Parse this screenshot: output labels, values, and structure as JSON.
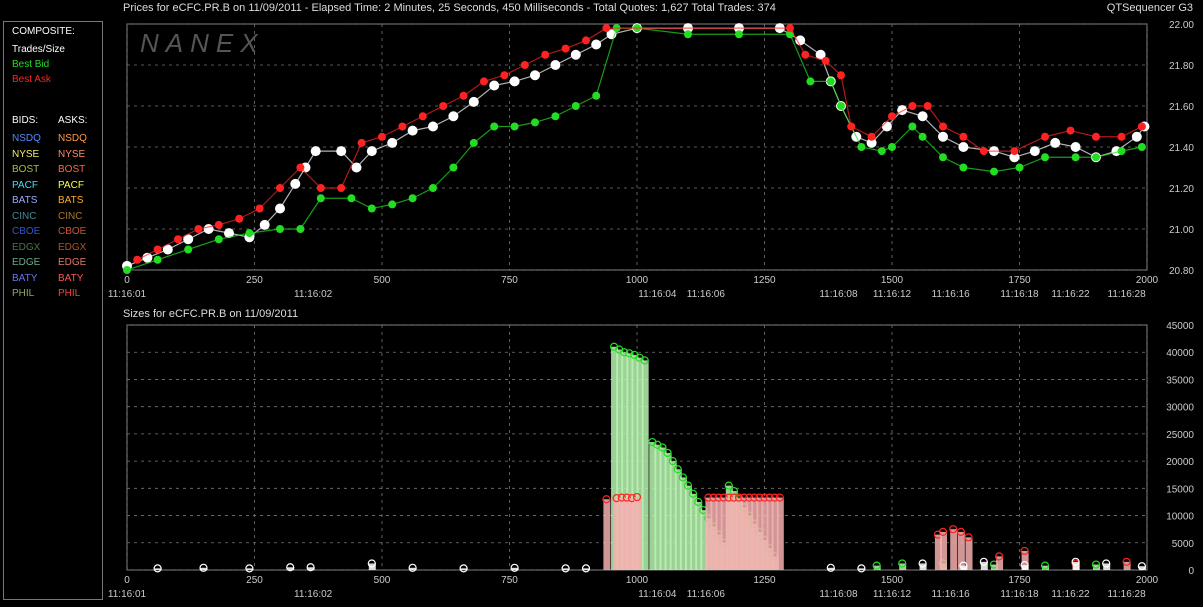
{
  "header": {
    "left": "Prices for  eCFC.PR.B  on  11/09/2011  -  Elapsed Time: 2 Minutes, 25 Seconds, 450 Milliseconds  -  Total Quotes: 1,627  Total Trades: 374",
    "right": "QTSequencer G3"
  },
  "sizes_title": "Sizes for  eCFC.PR.B  on  11/09/2011",
  "watermark": "NANEX",
  "legend": {
    "composite_title": "COMPOSITE:",
    "composite": [
      {
        "label": "Trades/Size",
        "color": "#ffffff"
      },
      {
        "label": "Best Bid",
        "color": "#22dd22"
      },
      {
        "label": "Best Ask",
        "color": "#ff2222"
      }
    ],
    "bids_title": "BIDS:",
    "asks_title": "ASKS:",
    "exchanges": [
      {
        "bid": "NSDQ",
        "ask": "NSDQ",
        "bid_color": "#5588ff",
        "ask_color": "#ff9944"
      },
      {
        "bid": "NYSE",
        "ask": "NYSE",
        "bid_color": "#eeee66",
        "ask_color": "#ff8866"
      },
      {
        "bid": "BOST",
        "ask": "BOST",
        "bid_color": "#aabb44",
        "ask_color": "#ff6644"
      },
      {
        "bid": "PACF",
        "ask": "PACF",
        "bid_color": "#44ddff",
        "ask_color": "#ffff44"
      },
      {
        "bid": "BATS",
        "ask": "BATS",
        "bid_color": "#99aaff",
        "ask_color": "#ffaa33"
      },
      {
        "bid": "CINC",
        "ask": "CINC",
        "bid_color": "#448899",
        "ask_color": "#aa7733"
      },
      {
        "bid": "CBOE",
        "ask": "CBOE",
        "bid_color": "#3355cc",
        "ask_color": "#cc5533"
      },
      {
        "bid": "EDGX",
        "ask": "EDGX",
        "bid_color": "#447744",
        "ask_color": "#aa5522"
      },
      {
        "bid": "EDGE",
        "ask": "EDGE",
        "bid_color": "#66aa88",
        "ask_color": "#dd7766"
      },
      {
        "bid": "BATY",
        "ask": "BATY",
        "bid_color": "#6677ee",
        "ask_color": "#ff5555"
      },
      {
        "bid": "PHIL",
        "ask": "PHIL",
        "bid_color": "#88aa66",
        "ask_color": "#ee4444"
      }
    ]
  },
  "chart_data": [
    {
      "type": "scatter",
      "title": "Prices for  eCFC.PR.B  on  11/09/2011",
      "xlim": [
        0,
        2000
      ],
      "ylim": [
        20.8,
        22.0
      ],
      "x_ticks": [
        0,
        250,
        500,
        750,
        1000,
        1250,
        1500,
        1750,
        2000
      ],
      "y_ticks": [
        20.8,
        21.0,
        21.2,
        21.4,
        21.6,
        21.8,
        22.0
      ],
      "y_tick_labels": [
        "20.80",
        "21.00",
        "21.20",
        "21.40",
        "21.60",
        "21.80",
        "22.00"
      ],
      "time_labels": [
        {
          "x": 0,
          "label": "11:16:01"
        },
        {
          "x": 365,
          "label": "11:16:02"
        },
        {
          "x": 1040,
          "label": "11:16:04"
        },
        {
          "x": 1135,
          "label": "11:16:06"
        },
        {
          "x": 1395,
          "label": "11:16:08"
        },
        {
          "x": 1500,
          "label": "11:16:12"
        },
        {
          "x": 1615,
          "label": "11:16:16"
        },
        {
          "x": 1750,
          "label": "11:16:18"
        },
        {
          "x": 1850,
          "label": "11:16:22"
        },
        {
          "x": 1960,
          "label": "11:16:28"
        }
      ],
      "series": [
        {
          "name": "Trades/Size",
          "color": "#ffffff",
          "points": [
            [
              0,
              20.82
            ],
            [
              40,
              20.86
            ],
            [
              80,
              20.9
            ],
            [
              120,
              20.95
            ],
            [
              160,
              21.0
            ],
            [
              200,
              20.98
            ],
            [
              240,
              20.96
            ],
            [
              270,
              21.02
            ],
            [
              300,
              21.1
            ],
            [
              330,
              21.22
            ],
            [
              350,
              21.3
            ],
            [
              370,
              21.38
            ],
            [
              420,
              21.38
            ],
            [
              450,
              21.3
            ],
            [
              480,
              21.38
            ],
            [
              520,
              21.42
            ],
            [
              560,
              21.48
            ],
            [
              600,
              21.5
            ],
            [
              640,
              21.55
            ],
            [
              680,
              21.62
            ],
            [
              720,
              21.7
            ],
            [
              760,
              21.72
            ],
            [
              800,
              21.75
            ],
            [
              840,
              21.8
            ],
            [
              880,
              21.85
            ],
            [
              920,
              21.9
            ],
            [
              950,
              21.95
            ],
            [
              1000,
              21.98
            ],
            [
              1100,
              21.98
            ],
            [
              1200,
              21.98
            ],
            [
              1280,
              21.98
            ],
            [
              1320,
              21.92
            ],
            [
              1360,
              21.85
            ],
            [
              1380,
              21.72
            ],
            [
              1400,
              21.6
            ],
            [
              1430,
              21.45
            ],
            [
              1460,
              21.42
            ],
            [
              1490,
              21.5
            ],
            [
              1520,
              21.58
            ],
            [
              1560,
              21.55
            ],
            [
              1600,
              21.45
            ],
            [
              1640,
              21.4
            ],
            [
              1700,
              21.38
            ],
            [
              1740,
              21.35
            ],
            [
              1780,
              21.38
            ],
            [
              1820,
              21.42
            ],
            [
              1860,
              21.4
            ],
            [
              1900,
              21.35
            ],
            [
              1940,
              21.38
            ],
            [
              1980,
              21.45
            ],
            [
              1995,
              21.5
            ]
          ]
        },
        {
          "name": "Best Bid",
          "color": "#22dd22",
          "points": [
            [
              0,
              20.8
            ],
            [
              60,
              20.85
            ],
            [
              120,
              20.9
            ],
            [
              180,
              20.95
            ],
            [
              240,
              20.98
            ],
            [
              300,
              21.0
            ],
            [
              340,
              21.0
            ],
            [
              380,
              21.15
            ],
            [
              440,
              21.15
            ],
            [
              480,
              21.1
            ],
            [
              520,
              21.12
            ],
            [
              560,
              21.15
            ],
            [
              600,
              21.2
            ],
            [
              640,
              21.3
            ],
            [
              680,
              21.42
            ],
            [
              720,
              21.5
            ],
            [
              760,
              21.5
            ],
            [
              800,
              21.52
            ],
            [
              840,
              21.55
            ],
            [
              880,
              21.6
            ],
            [
              920,
              21.65
            ],
            [
              960,
              21.98
            ],
            [
              1000,
              21.98
            ],
            [
              1100,
              21.95
            ],
            [
              1200,
              21.95
            ],
            [
              1300,
              21.95
            ],
            [
              1340,
              21.72
            ],
            [
              1380,
              21.72
            ],
            [
              1400,
              21.6
            ],
            [
              1440,
              21.4
            ],
            [
              1480,
              21.38
            ],
            [
              1500,
              21.4
            ],
            [
              1540,
              21.5
            ],
            [
              1560,
              21.45
            ],
            [
              1600,
              21.35
            ],
            [
              1640,
              21.3
            ],
            [
              1700,
              21.28
            ],
            [
              1750,
              21.3
            ],
            [
              1800,
              21.35
            ],
            [
              1860,
              21.35
            ],
            [
              1900,
              21.35
            ],
            [
              1950,
              21.38
            ],
            [
              1990,
              21.4
            ]
          ]
        },
        {
          "name": "Best Ask",
          "color": "#ff2222",
          "points": [
            [
              20,
              20.85
            ],
            [
              60,
              20.9
            ],
            [
              100,
              20.95
            ],
            [
              140,
              21.0
            ],
            [
              180,
              21.02
            ],
            [
              220,
              21.05
            ],
            [
              260,
              21.1
            ],
            [
              300,
              21.2
            ],
            [
              340,
              21.3
            ],
            [
              380,
              21.2
            ],
            [
              420,
              21.2
            ],
            [
              460,
              21.42
            ],
            [
              500,
              21.45
            ],
            [
              540,
              21.5
            ],
            [
              580,
              21.55
            ],
            [
              620,
              21.6
            ],
            [
              660,
              21.65
            ],
            [
              700,
              21.72
            ],
            [
              740,
              21.75
            ],
            [
              780,
              21.8
            ],
            [
              820,
              21.85
            ],
            [
              860,
              21.88
            ],
            [
              900,
              21.92
            ],
            [
              940,
              21.98
            ],
            [
              1300,
              21.98
            ],
            [
              1330,
              21.85
            ],
            [
              1370,
              21.82
            ],
            [
              1400,
              21.75
            ],
            [
              1420,
              21.5
            ],
            [
              1460,
              21.45
            ],
            [
              1500,
              21.55
            ],
            [
              1540,
              21.6
            ],
            [
              1570,
              21.6
            ],
            [
              1600,
              21.5
            ],
            [
              1640,
              21.45
            ],
            [
              1680,
              21.38
            ],
            [
              1740,
              21.38
            ],
            [
              1800,
              21.45
            ],
            [
              1850,
              21.48
            ],
            [
              1900,
              21.45
            ],
            [
              1950,
              21.45
            ],
            [
              1990,
              21.5
            ]
          ]
        }
      ]
    },
    {
      "type": "bar",
      "title": "Sizes for  eCFC.PR.B  on  11/09/2011",
      "xlim": [
        0,
        2000
      ],
      "ylim": [
        0,
        45000
      ],
      "x_ticks": [
        0,
        250,
        500,
        750,
        1000,
        1250,
        1500,
        1750,
        2000
      ],
      "y_ticks": [
        0,
        5000,
        10000,
        15000,
        20000,
        25000,
        30000,
        35000,
        40000,
        45000
      ],
      "series": [
        {
          "name": "Best Bid",
          "color": "#22dd22",
          "points": [
            [
              955,
              41000
            ],
            [
              965,
              40500
            ],
            [
              975,
              40000
            ],
            [
              985,
              39800
            ],
            [
              995,
              39500
            ],
            [
              1005,
              39000
            ],
            [
              1015,
              38500
            ],
            [
              1030,
              23500
            ],
            [
              1040,
              23000
            ],
            [
              1050,
              22500
            ],
            [
              1060,
              21500
            ],
            [
              1070,
              20000
            ],
            [
              1080,
              18500
            ],
            [
              1090,
              17000
            ],
            [
              1100,
              15500
            ],
            [
              1110,
              14000
            ],
            [
              1120,
              12500
            ],
            [
              1130,
              11000
            ],
            [
              1140,
              9500
            ],
            [
              1150,
              8000
            ],
            [
              1160,
              6500
            ],
            [
              1170,
              5000
            ],
            [
              1180,
              15500
            ],
            [
              1190,
              14500
            ],
            [
              1200,
              13000
            ],
            [
              1210,
              11500
            ],
            [
              1220,
              10000
            ],
            [
              1230,
              8500
            ],
            [
              1240,
              7000
            ],
            [
              1250,
              5500
            ],
            [
              1260,
              4000
            ],
            [
              1270,
              2500
            ],
            [
              1470,
              800
            ],
            [
              1520,
              1200
            ],
            [
              1600,
              1200
            ],
            [
              1700,
              1000
            ],
            [
              1800,
              800
            ],
            [
              1900,
              1000
            ]
          ]
        },
        {
          "name": "Best Ask",
          "color": "#ff2222",
          "points": [
            [
              940,
              13000
            ],
            [
              960,
              13200
            ],
            [
              970,
              13300
            ],
            [
              980,
              13300
            ],
            [
              990,
              13200
            ],
            [
              1000,
              13400
            ],
            [
              1140,
              13300
            ],
            [
              1150,
              13300
            ],
            [
              1160,
              13300
            ],
            [
              1170,
              13300
            ],
            [
              1180,
              13300
            ],
            [
              1190,
              13300
            ],
            [
              1200,
              13300
            ],
            [
              1210,
              13300
            ],
            [
              1220,
              13300
            ],
            [
              1230,
              13300
            ],
            [
              1240,
              13300
            ],
            [
              1250,
              13300
            ],
            [
              1260,
              13300
            ],
            [
              1270,
              13300
            ],
            [
              1280,
              13300
            ],
            [
              1590,
              6500
            ],
            [
              1600,
              7000
            ],
            [
              1620,
              7500
            ],
            [
              1635,
              7000
            ],
            [
              1650,
              6000
            ],
            [
              1710,
              2500
            ],
            [
              1760,
              3500
            ],
            [
              1860,
              1200
            ],
            [
              1960,
              1500
            ]
          ]
        },
        {
          "name": "Trades/Size",
          "color": "#ffffff",
          "points": [
            [
              60,
              300
            ],
            [
              150,
              400
            ],
            [
              240,
              300
            ],
            [
              320,
              500
            ],
            [
              360,
              500
            ],
            [
              480,
              1200
            ],
            [
              560,
              400
            ],
            [
              660,
              300
            ],
            [
              760,
              400
            ],
            [
              860,
              300
            ],
            [
              900,
              300
            ],
            [
              1380,
              400
            ],
            [
              1440,
              300
            ],
            [
              1560,
              1200
            ],
            [
              1640,
              800
            ],
            [
              1680,
              1500
            ],
            [
              1760,
              900
            ],
            [
              1860,
              1500
            ],
            [
              1920,
              1200
            ],
            [
              1990,
              700
            ]
          ]
        }
      ]
    }
  ]
}
